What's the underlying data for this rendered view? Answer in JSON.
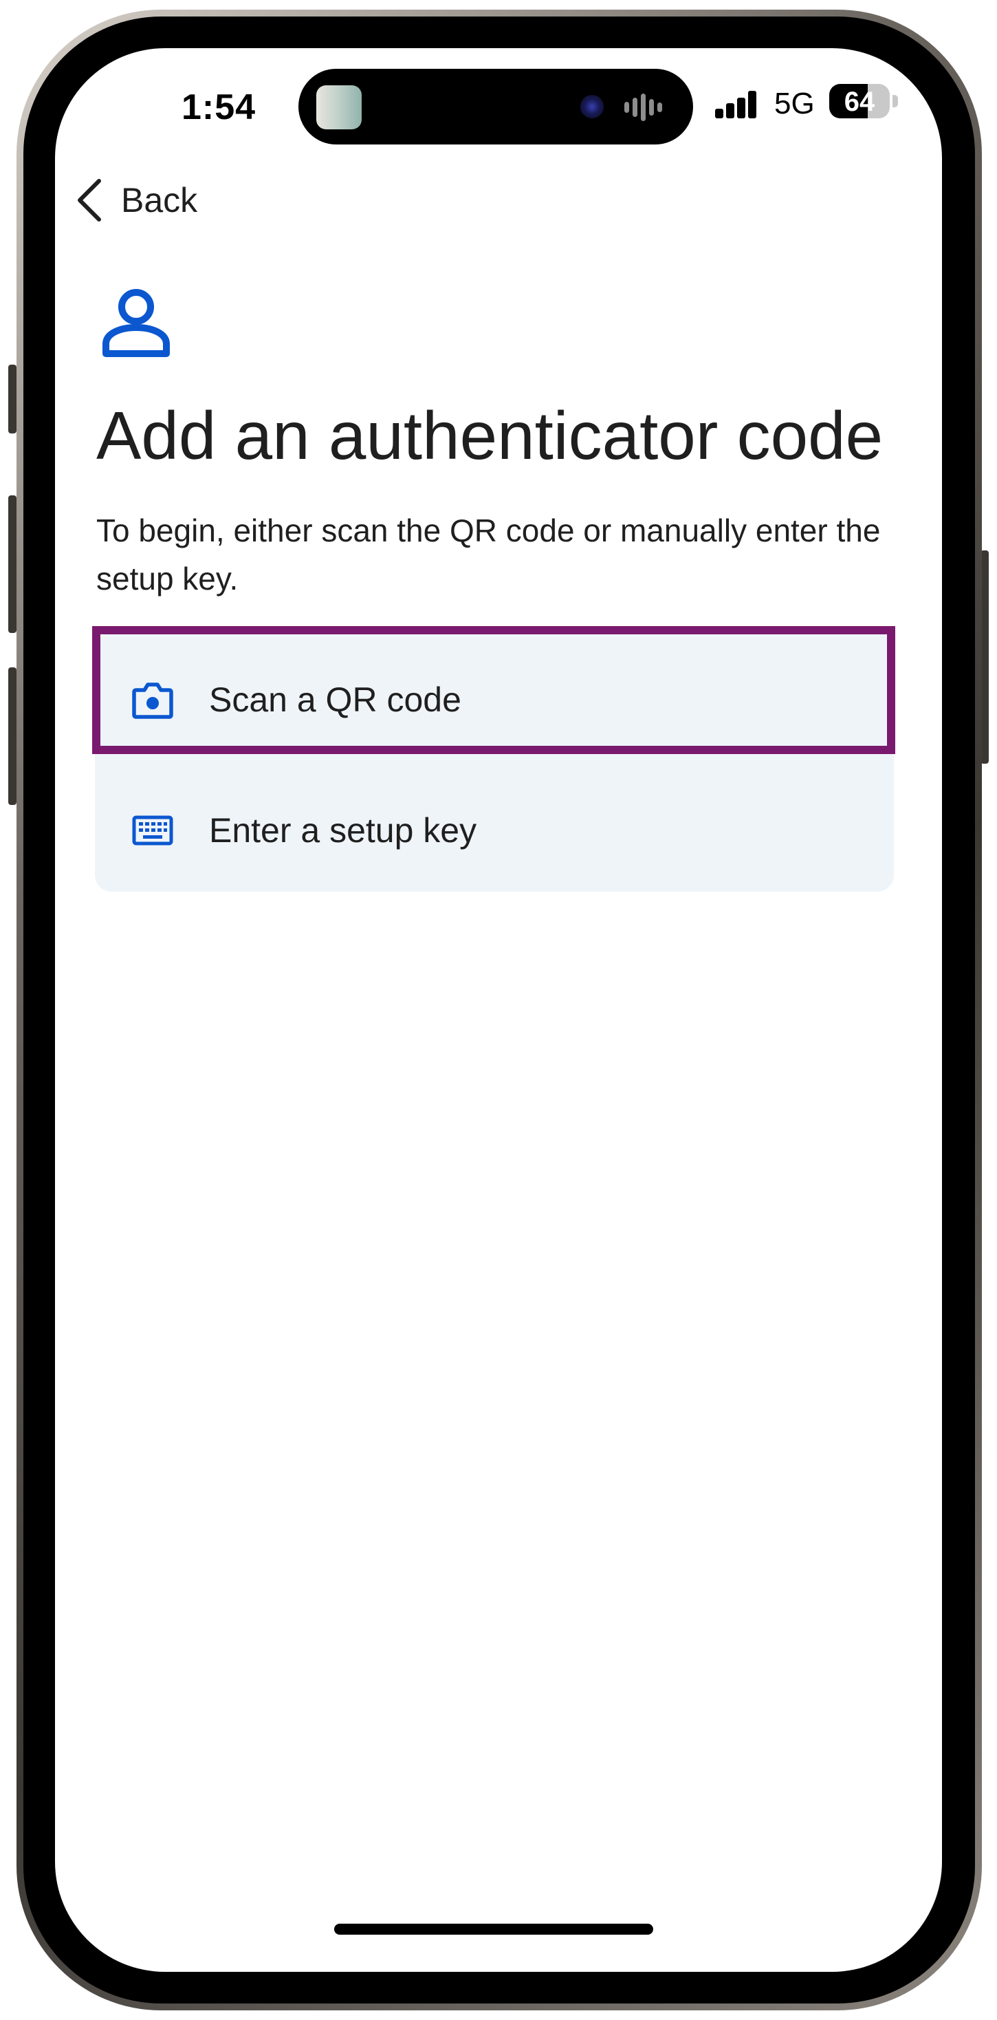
{
  "status_bar": {
    "time": "1:54",
    "network": "5G",
    "battery_level": "64"
  },
  "nav": {
    "back_label": "Back"
  },
  "header": {
    "icon": "person-icon",
    "title": "Add an authenticator code",
    "subtitle": "To begin, either scan the QR code or manually enter the setup key."
  },
  "options": [
    {
      "label": "Scan a QR code",
      "icon": "camera-icon"
    },
    {
      "label": "Enter a setup key",
      "icon": "keyboard-icon"
    }
  ],
  "colors": {
    "accent": "#0b57d0",
    "option_background": "#eff4f9",
    "highlight_border": "#7a1a6e",
    "text": "#1f1f1f"
  }
}
